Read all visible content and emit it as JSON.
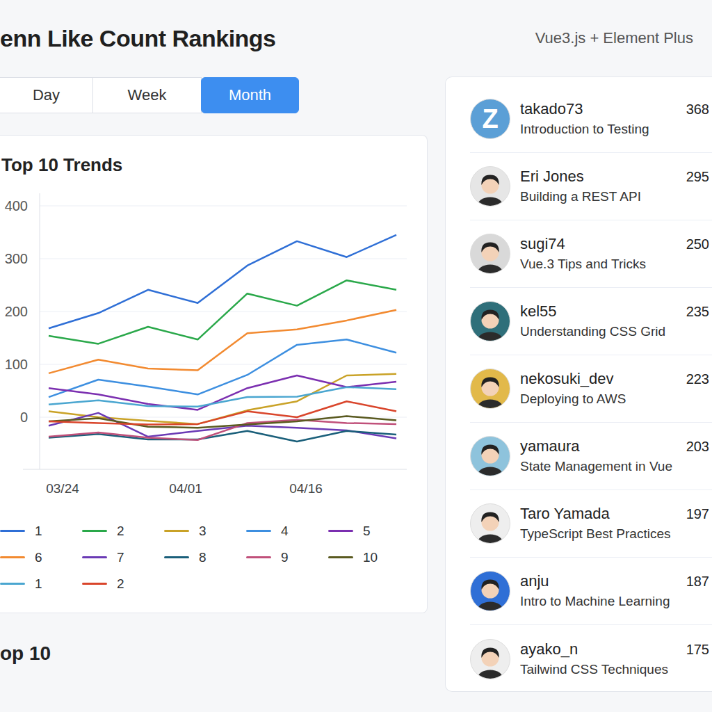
{
  "header": {
    "title": "enn Like Count Rankings",
    "subtitle": "Vue3.js + Element Plus"
  },
  "tabs": [
    {
      "label": "Day",
      "selected": false
    },
    {
      "label": "Week",
      "selected": false
    },
    {
      "label": "Month",
      "selected": true
    }
  ],
  "chart": {
    "title": "Top 10 Trends",
    "y_ticks": [
      "400",
      "300",
      "200",
      "100",
      "0"
    ],
    "x_labels": [
      "03/24",
      "04/01",
      "04/16"
    ],
    "series": [
      {
        "name": "1",
        "color": "#2f6fd6",
        "values": [
          168,
          197,
          241,
          216,
          287,
          333,
          303,
          345
        ]
      },
      {
        "name": "2",
        "color": "#2aa84a",
        "values": [
          154,
          139,
          171,
          147,
          234,
          211,
          259,
          241
        ]
      },
      {
        "name": "3",
        "color": "#c9a227",
        "values": [
          11,
          0,
          -7,
          -13,
          13,
          30,
          79,
          82
        ]
      },
      {
        "name": "4",
        "color": "#3d8fe0",
        "values": [
          38,
          71,
          58,
          43,
          80,
          137,
          147,
          122
        ]
      },
      {
        "name": "5",
        "color": "#7b2fb0",
        "values": [
          55,
          43,
          25,
          14,
          55,
          79,
          57,
          67
        ]
      },
      {
        "name": "6",
        "color": "#f28a30",
        "values": [
          83,
          109,
          92,
          89,
          159,
          166,
          183,
          203
        ]
      },
      {
        "name": "7",
        "color": "#6a3ab5",
        "values": [
          -16,
          8,
          -37,
          -26,
          -16,
          -20,
          -25,
          -40
        ]
      },
      {
        "name": "8",
        "color": "#1a5f7a",
        "values": [
          -39,
          -32,
          -42,
          -42,
          -26,
          -46,
          -26,
          -33
        ]
      },
      {
        "name": "9",
        "color": "#c0507a",
        "values": [
          -37,
          -29,
          -39,
          -43,
          -11,
          -5,
          -11,
          -13
        ]
      },
      {
        "name": "10",
        "color": "#5a5a20",
        "values": [
          -8,
          -2,
          -18,
          -20,
          -14,
          -8,
          2,
          -6
        ]
      },
      {
        "name": "1",
        "color": "#4aa6d0",
        "values": [
          24,
          32,
          21,
          20,
          38,
          39,
          57,
          53
        ]
      },
      {
        "name": "2",
        "color": "#d9452b",
        "values": [
          -8,
          -11,
          -14,
          -13,
          11,
          0,
          30,
          11
        ]
      }
    ]
  },
  "section_title": "op 10",
  "rankings": [
    {
      "name": "takado73",
      "title": "Introduction to Testing",
      "count": "368",
      "kind": "logo",
      "avatar_text": "Z",
      "color": "#5b9fd6"
    },
    {
      "name": "Eri Jones",
      "title": "Building a REST API",
      "count": "295",
      "kind": "photo",
      "color": "#e6e6e6"
    },
    {
      "name": "sugi74",
      "title": "Vue.3 Tips and Tricks",
      "count": "250",
      "kind": "photo",
      "color": "#d9d9d9"
    },
    {
      "name": "kel55",
      "title": "Understanding CSS Grid",
      "count": "235",
      "kind": "photo",
      "color": "#2f6f7a"
    },
    {
      "name": "nekosuki_dev",
      "title": "Deploying to AWS",
      "count": "223",
      "kind": "photo",
      "color": "#e2b94a"
    },
    {
      "name": "yamaura",
      "title": "State Management in Vue",
      "count": "203",
      "kind": "photo",
      "color": "#8ec3dc"
    },
    {
      "name": "Taro Yamada",
      "title": "TypeScript Best Practices",
      "count": "197",
      "kind": "photo",
      "color": "#eeeeee"
    },
    {
      "name": "anju",
      "title": "Intro to Machine Learning",
      "count": "187",
      "kind": "photo",
      "color": "#2f6fd6"
    },
    {
      "name": "ayako_n",
      "title": "Tailwind CSS Techniques",
      "count": "175",
      "kind": "photo",
      "color": "#eeeeee"
    }
  ]
}
